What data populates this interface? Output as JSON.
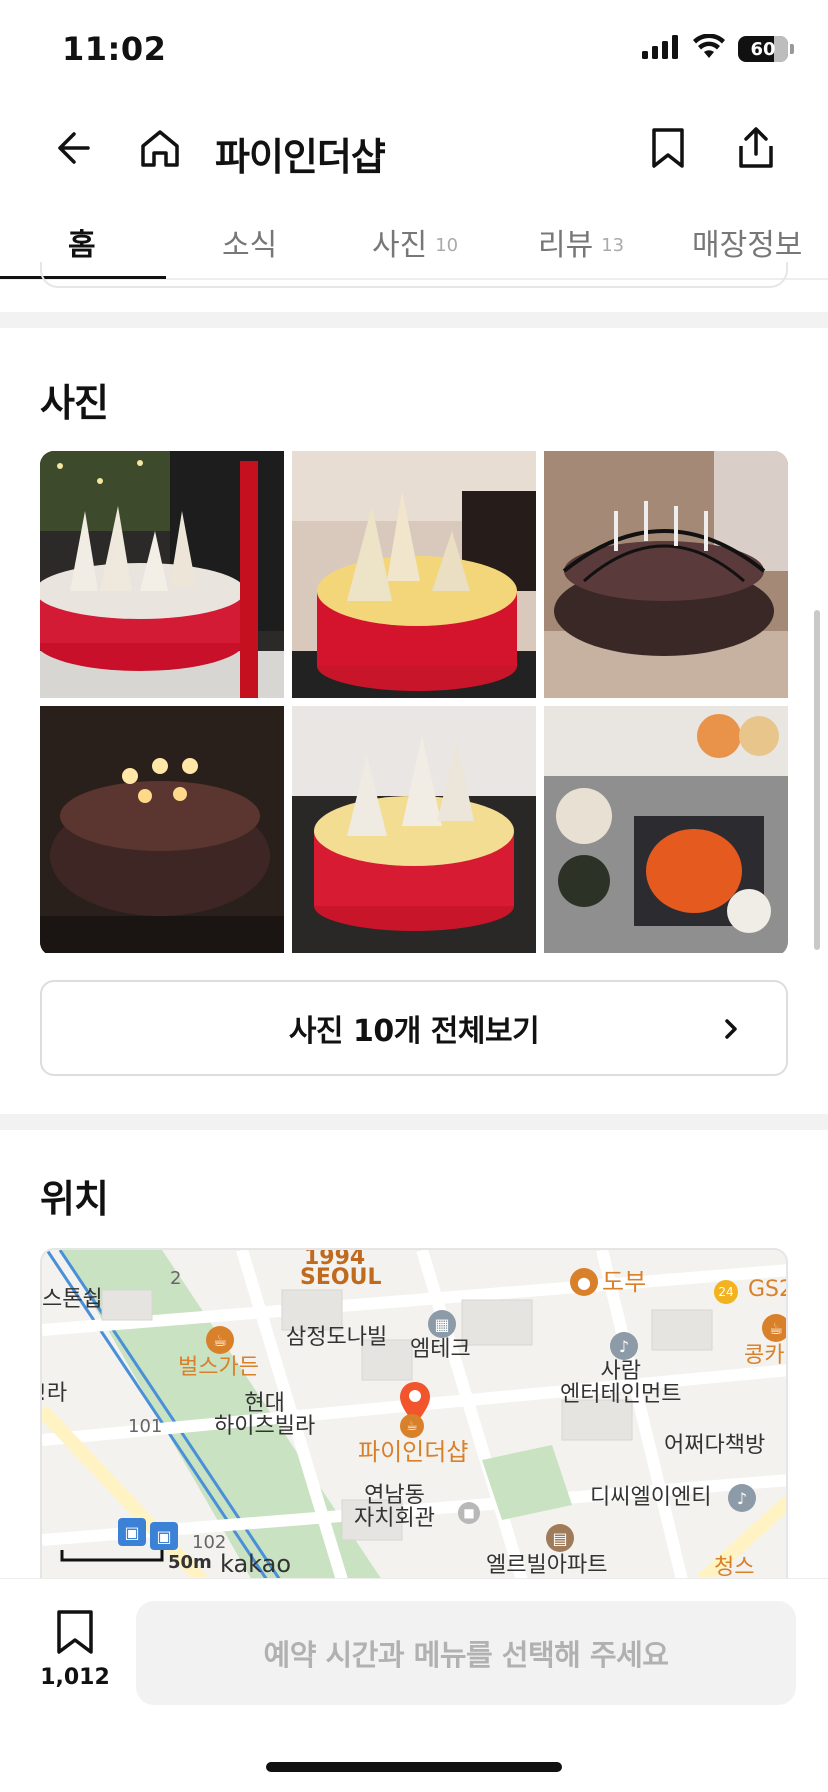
{
  "status_bar": {
    "time": "11:02",
    "battery_level": "60"
  },
  "header": {
    "title": "파이인더샵",
    "back_icon": "back-arrow-icon",
    "home_icon": "home-icon",
    "bookmark_icon": "bookmark-icon",
    "share_icon": "share-icon"
  },
  "tabs": [
    {
      "label": "홈",
      "count": "",
      "active": true
    },
    {
      "label": "소식",
      "count": "",
      "active": false
    },
    {
      "label": "사진",
      "count": "10",
      "active": false
    },
    {
      "label": "리뷰",
      "count": "13",
      "active": false
    },
    {
      "label": "매장정보",
      "count": "",
      "active": false
    }
  ],
  "photos_section": {
    "title": "사진",
    "view_all_label": "사진 10개 전체보기"
  },
  "location_section": {
    "title": "위치",
    "map": {
      "labels": {
        "l1994": "1994",
        "seoul": "SEOUL",
        "dobu": "도부",
        "gs": "GS2",
        "stone": "스톤쉽",
        "num2": "2",
        "samjung": "삼정도나빌",
        "emtech": "엠테크",
        "bulls": "벌스가든",
        "kong": "콩카",
        "saram": "사람\n엔터테인먼트",
        "ra": "!라",
        "hyundai": "현대\n하이츠빌라",
        "num101": "101",
        "pinder": "파이인더샵",
        "eojjeo": "어쩌다책방",
        "yeonnam": "연남동\n자치회관",
        "dcl": "디씨엘이엔티",
        "num102": "102",
        "scale": "50m",
        "kakao": "kakao",
        "elle": "엘르빌아파트",
        "cheong": "청스"
      }
    }
  },
  "bottom_bar": {
    "bookmark_count": "1,012",
    "reserve_label": "예약 시간과 메뉴를 선택해 주세요"
  },
  "colors": {
    "accent_orange": "#d9802b",
    "pin_red": "#f2552c",
    "text_primary": "#111111",
    "text_muted": "#777777"
  }
}
